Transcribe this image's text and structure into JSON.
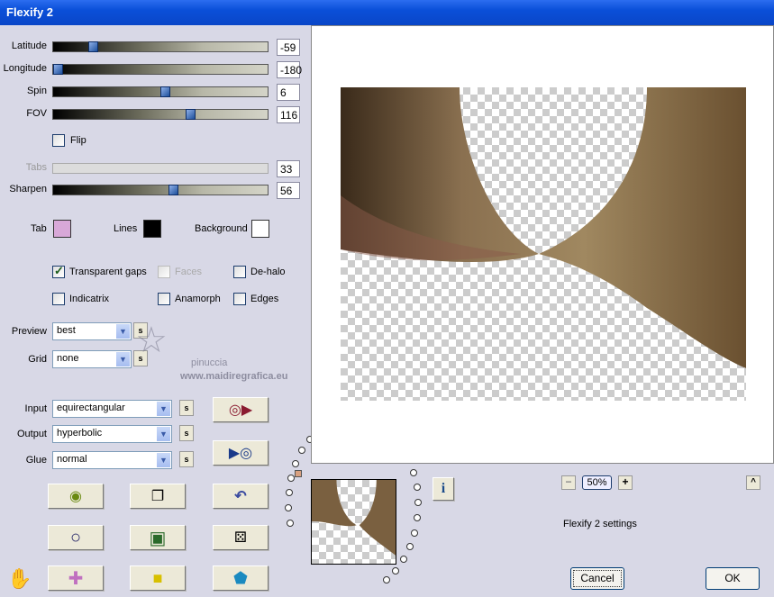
{
  "window": {
    "title": "Flexify 2"
  },
  "sliders": [
    {
      "label": "Latitude",
      "value": "-59",
      "fraction": 0.17
    },
    {
      "label": "Longitude",
      "value": "-180",
      "fraction": 0.0
    },
    {
      "label": "Spin",
      "value": "6",
      "fraction": 0.52
    },
    {
      "label": "FOV",
      "value": "116",
      "fraction": 0.64
    },
    {
      "label": "Tabs",
      "value": "33",
      "fraction": null,
      "disabled": true
    },
    {
      "label": "Sharpen",
      "value": "56",
      "fraction": 0.56
    }
  ],
  "flip": {
    "label": "Flip",
    "checked": false
  },
  "colors": {
    "tab_label": "Tab",
    "tab": "#d8a8d8",
    "lines_label": "Lines",
    "lines": "#000000",
    "background_label": "Background",
    "background": "#ffffff"
  },
  "options": [
    {
      "label": "Transparent gaps",
      "checked": true
    },
    {
      "label": "Faces",
      "checked": false,
      "disabled": true
    },
    {
      "label": "De-halo",
      "checked": false
    },
    {
      "label": "Indicatrix",
      "checked": false
    },
    {
      "label": "Anamorph",
      "checked": false
    },
    {
      "label": "Edges",
      "checked": false
    }
  ],
  "preview_select": {
    "label": "Preview",
    "value": "best"
  },
  "grid_select": {
    "label": "Grid",
    "value": "none"
  },
  "input_select": {
    "label": "Input",
    "value": "equirectangular"
  },
  "output_select": {
    "label": "Output",
    "value": "hyperbolic"
  },
  "glue_select": {
    "label": "Glue",
    "value": "normal"
  },
  "s_label": "s",
  "watermark": {
    "line1": "pinuccia",
    "line2": "www.maidiregrafica.eu"
  },
  "zoom": {
    "minus": "−",
    "value": "50%",
    "plus": "+"
  },
  "collapse": "^",
  "info": "i",
  "status": "Flexify 2 settings",
  "cancel": "Cancel",
  "ok": "OK"
}
